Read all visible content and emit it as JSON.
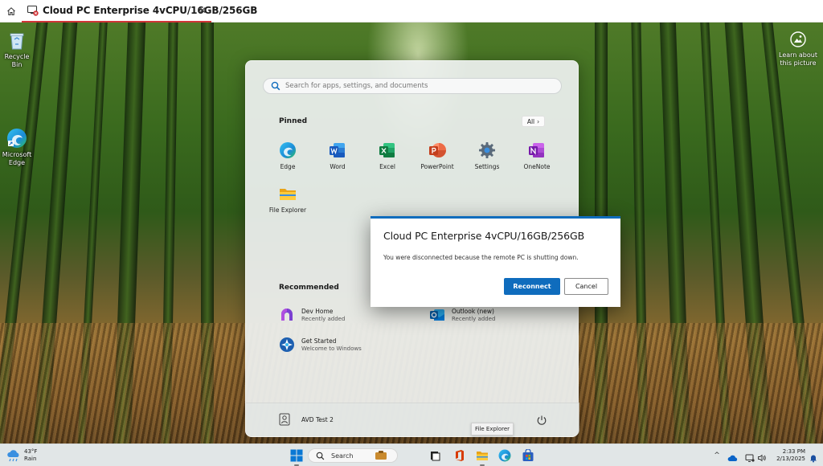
{
  "tab": {
    "title": "Cloud PC Enterprise 4vCPU/16GB/256GB",
    "close_glyph": "✕",
    "icon": "cloud-pc-icon",
    "home_icon": "home-icon"
  },
  "desktop": {
    "icons": [
      {
        "label": "Recycle Bin",
        "icon": "recycle-bin-icon"
      },
      {
        "label": "Microsoft Edge",
        "icon": "edge-icon"
      }
    ],
    "learn_picture": {
      "label": "Learn about this picture",
      "icon": "camera-icon"
    }
  },
  "start_menu": {
    "search_placeholder": "Search for apps, settings, and documents",
    "pinned_title": "Pinned",
    "all_label": "All",
    "all_glyph": "›",
    "pinned": [
      {
        "label": "Edge",
        "icon": "edge-icon"
      },
      {
        "label": "Word",
        "icon": "word-icon"
      },
      {
        "label": "Excel",
        "icon": "excel-icon"
      },
      {
        "label": "PowerPoint",
        "icon": "powerpoint-icon"
      },
      {
        "label": "Settings",
        "icon": "settings-icon"
      },
      {
        "label": "OneNote",
        "icon": "onenote-icon"
      },
      {
        "label": "File Explorer",
        "icon": "file-explorer-icon"
      }
    ],
    "recommended_title": "Recommended",
    "recommended": [
      {
        "title": "Dev Home",
        "subtitle": "Recently added",
        "icon": "dev-home-icon"
      },
      {
        "title": "Outlook (new)",
        "subtitle": "Recently added",
        "icon": "outlook-icon"
      },
      {
        "title": "Get Started",
        "subtitle": "Welcome to Windows",
        "icon": "get-started-icon"
      }
    ],
    "user_name": "AVD Test 2",
    "tooltip": "File Explorer"
  },
  "dialog": {
    "title": "Cloud PC Enterprise 4vCPU/16GB/256GB",
    "message": "You were disconnected because the remote PC is shutting down.",
    "primary_label": "Reconnect",
    "secondary_label": "Cancel",
    "accent": "#0f6cbd"
  },
  "taskbar": {
    "weather_temp": "43°F",
    "weather_desc": "Rain",
    "search_label": "Search",
    "tray_chevron": "^",
    "clock_time": "2:33 PM",
    "clock_date": "2/13/2025"
  },
  "colors": {
    "tab_accent": "#d13438",
    "primary": "#0f6cbd"
  }
}
